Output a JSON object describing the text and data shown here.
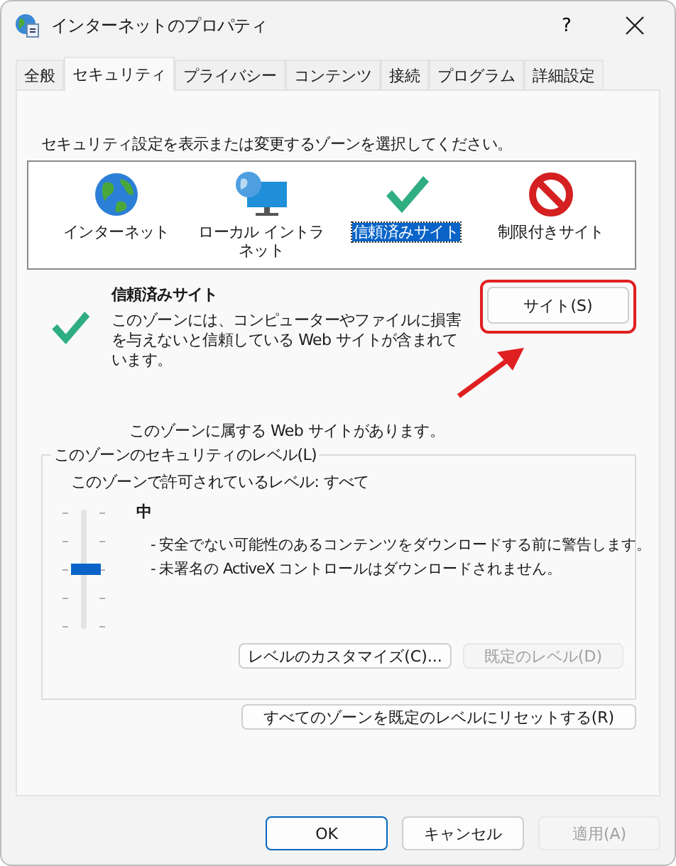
{
  "window": {
    "title": "インターネットのプロパティ",
    "help": "?"
  },
  "tabs": [
    {
      "label": "全般",
      "selected": false
    },
    {
      "label": "セキュリティ",
      "selected": true
    },
    {
      "label": "プライバシー",
      "selected": false
    },
    {
      "label": "コンテンツ",
      "selected": false
    },
    {
      "label": "接続",
      "selected": false
    },
    {
      "label": "プログラム",
      "selected": false
    },
    {
      "label": "詳細設定",
      "selected": false
    }
  ],
  "prompt": "セキュリティ設定を表示または変更するゾーンを選択してください。",
  "zones": [
    {
      "label": "インターネット",
      "kind": "internet",
      "selected": false
    },
    {
      "label": "ローカル イントラネット",
      "kind": "intranet",
      "selected": false
    },
    {
      "label": "信頼済みサイト",
      "kind": "trusted",
      "selected": true
    },
    {
      "label": "制限付きサイト",
      "kind": "restricted",
      "selected": false
    }
  ],
  "zone_info": {
    "kind": "trusted",
    "title": "信頼済みサイト",
    "description": "このゾーンには、コンピューターやファイルに損害を与えないと信頼している Web サイトが含まれています。",
    "sites_button": "サイト(S)",
    "membership": "このゾーンに属する Web サイトがあります。"
  },
  "security_level": {
    "legend": "このゾーンのセキュリティのレベル(L)",
    "allowed": "このゾーンで許可されているレベル: すべて",
    "level": 0.5,
    "name": "中",
    "bullets": [
      "- 安全でない可能性のあるコンテンツをダウンロードする前に警告します。",
      "- 未署名の ActiveX コントロールはダウンロードされません。"
    ],
    "buttons": [
      {
        "label": "レベルのカスタマイズ(C)...",
        "disabled": false
      },
      {
        "label": "既定のレベル(D)",
        "disabled": true
      }
    ]
  },
  "reset_button": {
    "label": "すべてのゾーンを既定のレベルにリセットする(R)",
    "disabled": false
  },
  "buttons": [
    {
      "label": "OK",
      "disabled": false,
      "default": true
    },
    {
      "label": "キャンセル",
      "disabled": false,
      "default": false
    },
    {
      "label": "適用(A)",
      "disabled": true,
      "default": false
    }
  ]
}
